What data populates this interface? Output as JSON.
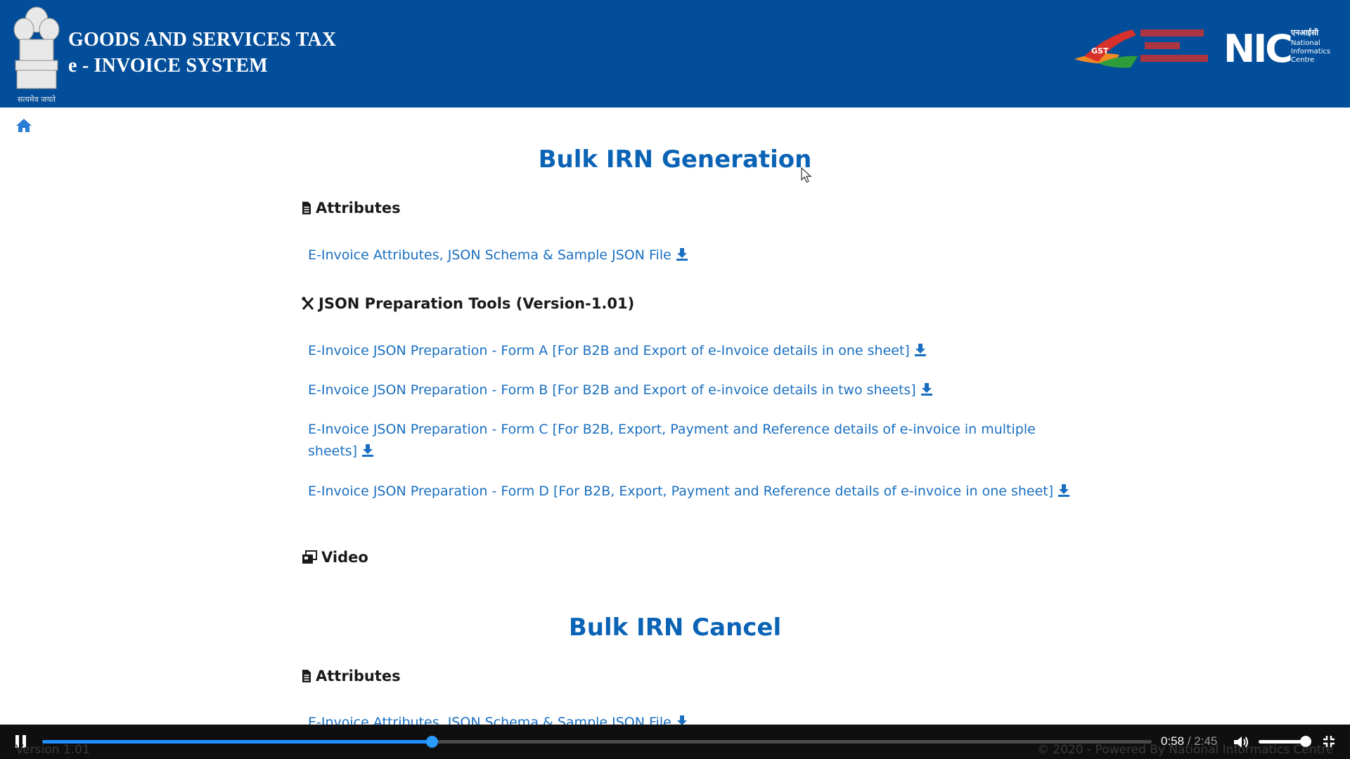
{
  "header": {
    "title_line1": "GOODS AND SERVICES TAX",
    "title_line2": "e - INVOICE SYSTEM",
    "emblem_caption": "सत्यमेव जयते",
    "logo_right_1": "GST",
    "logo_right_2": "NIC",
    "nic_hindi": "एनआईसी",
    "nic_caption": "National Informatics Centre"
  },
  "colors": {
    "header_bg": "#034e9a",
    "link": "#1a6fc0",
    "title": "#0b63b5",
    "progress": "#1e90ff"
  },
  "sections": [
    {
      "title": "Bulk IRN Generation",
      "attributes_heading": "Attributes",
      "attributes_link": "E-Invoice Attributes, JSON Schema & Sample JSON File",
      "tools_heading": "JSON Preparation Tools (Version-1.01)",
      "tools": [
        "E-Invoice JSON Preparation - Form A [For B2B and Export of e-Invoice details in one sheet]",
        "E-Invoice JSON Preparation - Form B [For B2B and Export of e-invoice details in two sheets]",
        "E-Invoice JSON Preparation - Form C [For B2B, Export, Payment and Reference details of e-invoice in multiple sheets]",
        "E-Invoice JSON Preparation - Form D [For B2B, Export, Payment and Reference details of e-invoice in one sheet]"
      ],
      "video_heading": "Video"
    },
    {
      "title": "Bulk IRN Cancel",
      "attributes_heading": "Attributes",
      "attributes_link": "E-Invoice Attributes, JSON Schema & Sample JSON File"
    }
  ],
  "player": {
    "current_time": "0:58",
    "separator": " / ",
    "duration": "2:45",
    "progress_fraction": 0.351,
    "volume_fraction": 0.85
  },
  "footer": {
    "version": "Version 1.01",
    "copyright": "© 2020 - Powered By National Informatics Centre"
  },
  "icons": [
    "home-icon",
    "file-icon",
    "tools-icon",
    "video-icon",
    "download-icon",
    "pause-icon",
    "volume-icon",
    "fullscreen-icon"
  ]
}
